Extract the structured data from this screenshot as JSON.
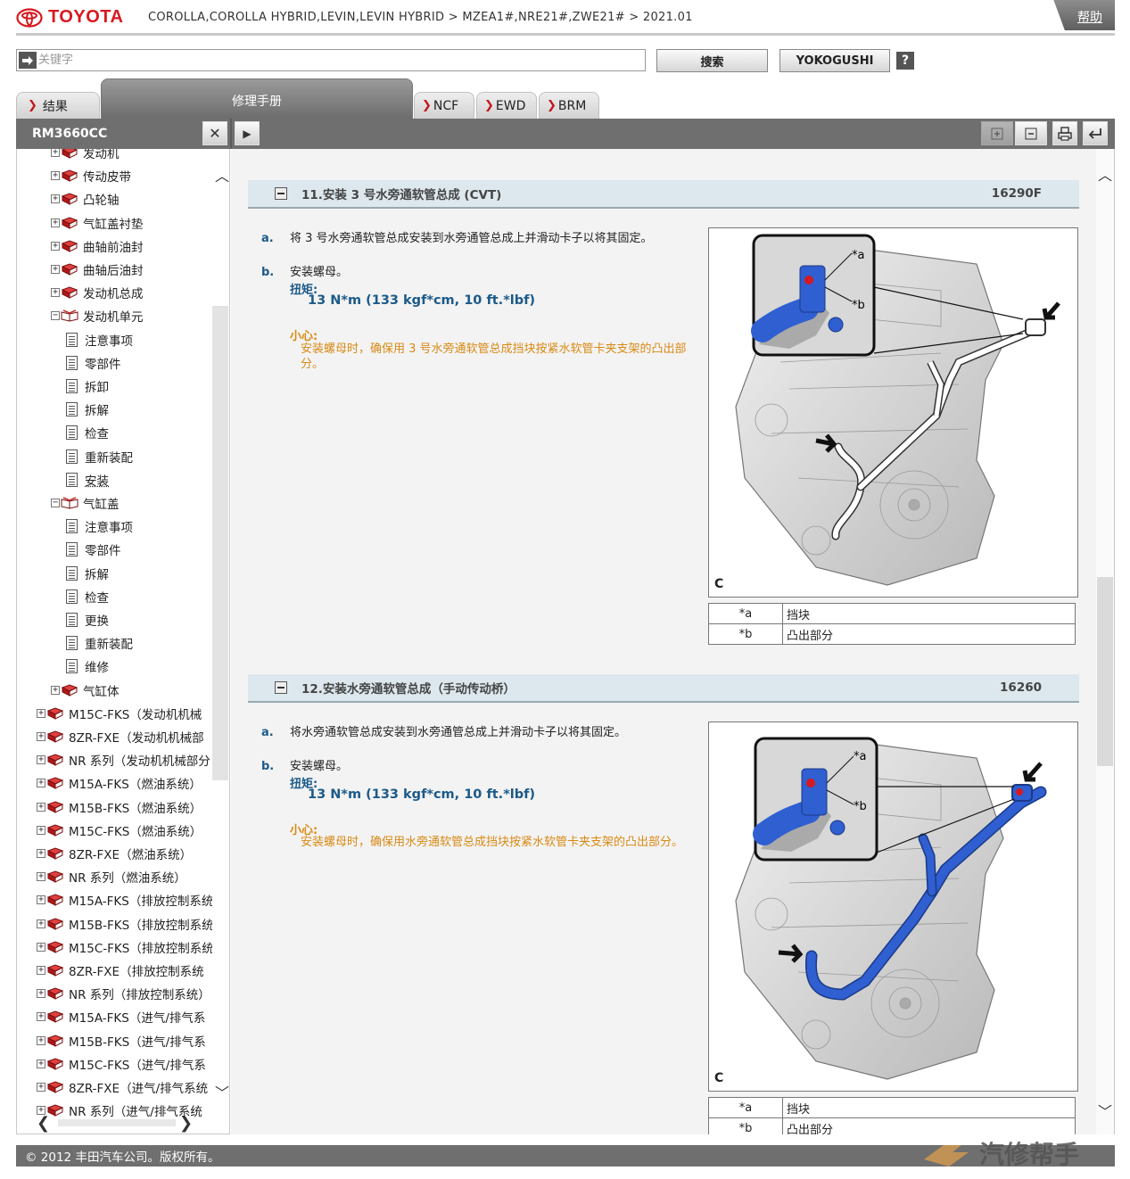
{
  "header": {
    "brand": "TOYOTA",
    "breadcrumb": "COROLLA,COROLLA HYBRID,LEVIN,LEVIN HYBRID > MZEA1#,NRE21#,ZWE21# > 2021.01",
    "help_label": "帮助"
  },
  "search": {
    "placeholder": "关键字",
    "value": "",
    "search_label": "搜索",
    "yokogushi_label": "YOKOGUSHI",
    "help_icon": "?"
  },
  "tabs": {
    "results": "结果",
    "manual": "修理手册",
    "ncf": "NCF",
    "ewd": "EWD",
    "brm": "BRM"
  },
  "toolbar": {
    "doc_id": "RM3660CC"
  },
  "tree": {
    "items": [
      {
        "label": "发动机",
        "type": "book",
        "pm": "+"
      },
      {
        "label": "传动皮带",
        "type": "book",
        "pm": "+"
      },
      {
        "label": "凸轮轴",
        "type": "book",
        "pm": "+"
      },
      {
        "label": "气缸盖衬垫",
        "type": "book",
        "pm": "+"
      },
      {
        "label": "曲轴前油封",
        "type": "book",
        "pm": "+"
      },
      {
        "label": "曲轴后油封",
        "type": "book",
        "pm": "+"
      },
      {
        "label": "发动机总成",
        "type": "book",
        "pm": "+"
      },
      {
        "label": "发动机单元",
        "type": "openbook",
        "pm": "−"
      },
      {
        "label": "注意事项",
        "type": "doc"
      },
      {
        "label": "零部件",
        "type": "doc"
      },
      {
        "label": "拆卸",
        "type": "doc"
      },
      {
        "label": "拆解",
        "type": "doc"
      },
      {
        "label": "检查",
        "type": "doc"
      },
      {
        "label": "重新装配",
        "type": "doc"
      },
      {
        "label": "安装",
        "type": "doc",
        "selected": true
      },
      {
        "label": "气缸盖",
        "type": "openbook",
        "pm": "−"
      },
      {
        "label": "注意事项",
        "type": "doc"
      },
      {
        "label": "零部件",
        "type": "doc"
      },
      {
        "label": "拆解",
        "type": "doc"
      },
      {
        "label": "检查",
        "type": "doc"
      },
      {
        "label": "更换",
        "type": "doc"
      },
      {
        "label": "重新装配",
        "type": "doc"
      },
      {
        "label": "维修",
        "type": "doc"
      },
      {
        "label": "气缸体",
        "type": "book",
        "pm": "+"
      },
      {
        "label": "M15C-FKS（发动机机械",
        "type": "book",
        "pm": "+",
        "level": 0
      },
      {
        "label": "8ZR-FXE（发动机机械部",
        "type": "book",
        "pm": "+",
        "level": 0
      },
      {
        "label": "NR 系列（发动机机械部分",
        "type": "book",
        "pm": "+",
        "level": 0
      },
      {
        "label": "M15A-FKS（燃油系统）",
        "type": "book",
        "pm": "+",
        "level": 0
      },
      {
        "label": "M15B-FKS（燃油系统）",
        "type": "book",
        "pm": "+",
        "level": 0
      },
      {
        "label": "M15C-FKS（燃油系统）",
        "type": "book",
        "pm": "+",
        "level": 0
      },
      {
        "label": "8ZR-FXE（燃油系统）",
        "type": "book",
        "pm": "+",
        "level": 0
      },
      {
        "label": "NR 系列（燃油系统）",
        "type": "book",
        "pm": "+",
        "level": 0
      },
      {
        "label": "M15A-FKS（排放控制系统",
        "type": "book",
        "pm": "+",
        "level": 0
      },
      {
        "label": "M15B-FKS（排放控制系统",
        "type": "book",
        "pm": "+",
        "level": 0
      },
      {
        "label": "M15C-FKS（排放控制系统",
        "type": "book",
        "pm": "+",
        "level": 0
      },
      {
        "label": "8ZR-FXE（排放控制系统",
        "type": "book",
        "pm": "+",
        "level": 0
      },
      {
        "label": "NR 系列（排放控制系统）",
        "type": "book",
        "pm": "+",
        "level": 0
      },
      {
        "label": "M15A-FKS（进气/排气系",
        "type": "book",
        "pm": "+",
        "level": 0
      },
      {
        "label": "M15B-FKS（进气/排气系",
        "type": "book",
        "pm": "+",
        "level": 0
      },
      {
        "label": "M15C-FKS（进气/排气系",
        "type": "book",
        "pm": "+",
        "level": 0
      },
      {
        "label": "8ZR-FXE（进气/排气系统",
        "type": "book",
        "pm": "+",
        "level": 0
      },
      {
        "label": "NR 系列（进气/排气系统",
        "type": "book",
        "pm": "+",
        "level": 0
      }
    ]
  },
  "steps": [
    {
      "title": "11.安装 3 号水旁通软管总成 (CVT)",
      "code": "16290F",
      "a_label": "a.",
      "a_text": "将 3 号水旁通软管总成安装到水旁通管总成上并滑动卡子以将其固定。",
      "b_label": "b.",
      "b_text": "安装螺母。",
      "torque_label": "扭矩:",
      "torque_value": "13 N*m (133 kgf*cm, 10 ft.*lbf)",
      "caution_label": "小心:",
      "caution_text": "安装螺母时，确保用 3 号水旁通软管总成挡块按紧水软管卡夹支架的凸出部分。",
      "figure_code": "C",
      "callout_a": "*a",
      "callout_b": "*b",
      "legend": [
        {
          "key": "*a",
          "value": "挡块"
        },
        {
          "key": "*b",
          "value": "凸出部分"
        }
      ]
    },
    {
      "title": "12.安装水旁通软管总成（手动传动桥）",
      "code": "16260",
      "a_label": "a.",
      "a_text": "将水旁通软管总成安装到水旁通管总成上并滑动卡子以将其固定。",
      "b_label": "b.",
      "b_text": "安装螺母。",
      "torque_label": "扭矩:",
      "torque_value": "13 N*m (133 kgf*cm, 10 ft.*lbf)",
      "caution_label": "小心:",
      "caution_text": "安装螺母时，确保用水旁通软管总成挡块按紧水软管卡夹支架的凸出部分。",
      "figure_code": "C",
      "callout_a": "*a",
      "callout_b": "*b",
      "legend": [
        {
          "key": "*a",
          "value": "挡块"
        },
        {
          "key": "*b",
          "value": "凸出部分"
        }
      ]
    }
  ],
  "footer": {
    "copyright": "© 2012 丰田汽车公司。版权所有。",
    "watermark": "汽修帮手"
  },
  "colors": {
    "brand_red": "#d71920",
    "link_blue": "#1c5a89",
    "caution_orange": "#d88a14",
    "hose_blue": "#2f5fd0"
  }
}
